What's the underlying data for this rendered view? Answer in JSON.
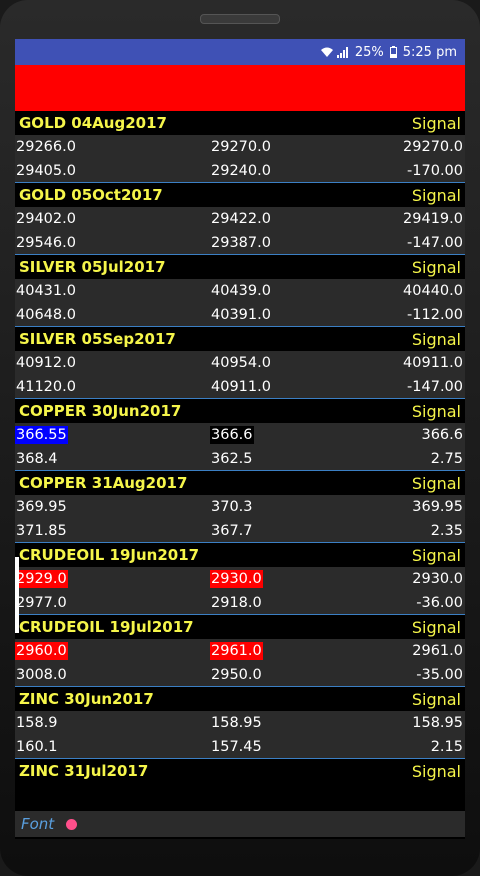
{
  "status": {
    "battery": "25%",
    "time": "5:25 pm"
  },
  "sections": [
    {
      "title": "GOLD 04Aug2017",
      "signal": "Signal",
      "rows": [
        [
          "29266.0",
          "29270.0",
          "29270.0"
        ],
        [
          "29405.0",
          "29240.0",
          "-170.00"
        ]
      ]
    },
    {
      "title": "GOLD 05Oct2017",
      "signal": "Signal",
      "rows": [
        [
          "29402.0",
          "29422.0",
          "29419.0"
        ],
        [
          "29546.0",
          "29387.0",
          "-147.00"
        ]
      ]
    },
    {
      "title": "SILVER 05Jul2017",
      "signal": "Signal",
      "rows": [
        [
          "40431.0",
          "40439.0",
          "40440.0"
        ],
        [
          "40648.0",
          "40391.0",
          "-112.00"
        ]
      ]
    },
    {
      "title": "SILVER 05Sep2017",
      "signal": "Signal",
      "rows": [
        [
          "40912.0",
          "40954.0",
          "40911.0"
        ],
        [
          "41120.0",
          "40911.0",
          "-147.00"
        ]
      ]
    },
    {
      "title": "COPPER 30Jun2017",
      "signal": "Signal",
      "rows": [
        [
          "366.55",
          "366.6",
          "366.6"
        ],
        [
          "368.4",
          "362.5",
          "2.75"
        ]
      ]
    },
    {
      "title": "COPPER 31Aug2017",
      "signal": "Signal",
      "rows": [
        [
          "369.95",
          "370.3",
          "369.95"
        ],
        [
          "371.85",
          "367.7",
          "2.35"
        ]
      ]
    },
    {
      "title": "CRUDEOIL 19Jun2017",
      "signal": "Signal",
      "rows": [
        [
          "2929.0",
          "2930.0",
          "2930.0"
        ],
        [
          "2977.0",
          "2918.0",
          "-36.00"
        ]
      ]
    },
    {
      "title": "CRUDEOIL 19Jul2017",
      "signal": "Signal",
      "rows": [
        [
          "2960.0",
          "2961.0",
          "2961.0"
        ],
        [
          "3008.0",
          "2950.0",
          "-35.00"
        ]
      ]
    },
    {
      "title": "ZINC 30Jun2017",
      "signal": "Signal",
      "rows": [
        [
          "158.9",
          "158.95",
          "158.95"
        ],
        [
          "160.1",
          "157.45",
          "2.15"
        ]
      ]
    },
    {
      "title": "ZINC 31Jul2017",
      "signal": "Signal",
      "rows": []
    }
  ],
  "footer": {
    "font_label": "Font"
  },
  "colors": {
    "status_bar": "#3f51b5",
    "header": "#ff0000",
    "title": "#f5f54a",
    "highlight_blue": "#0000ff",
    "highlight_red": "#ff0000"
  }
}
